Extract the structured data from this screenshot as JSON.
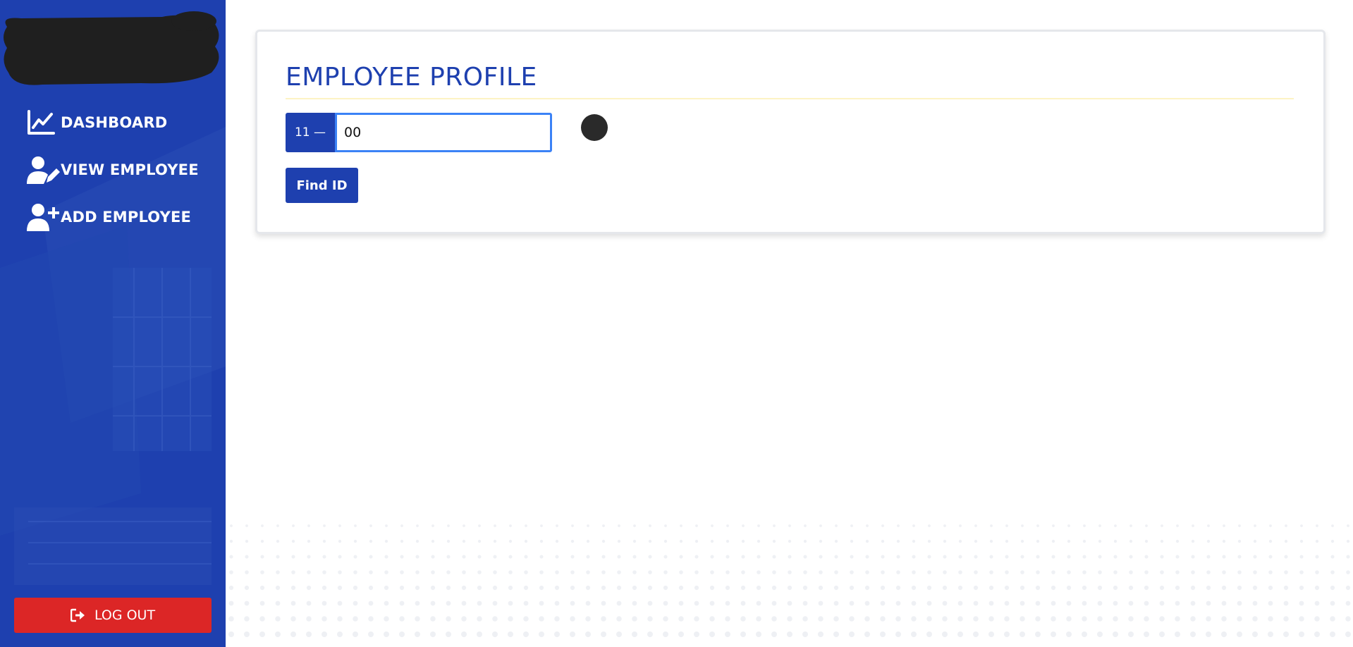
{
  "sidebar": {
    "items": [
      {
        "label": "DASHBOARD",
        "icon": "chart-line-icon"
      },
      {
        "label": "VIEW EMPLOYEE",
        "icon": "user-edit-icon"
      },
      {
        "label": "ADD EMPLOYEE",
        "icon": "user-plus-icon"
      }
    ],
    "logout": {
      "label": "LOG OUT",
      "icon": "sign-out-icon"
    }
  },
  "main": {
    "title": "EMPLOYEE PROFILE",
    "id_prefix": "11 —",
    "id_input": {
      "value": "00"
    },
    "find_button": "Find ID"
  },
  "colors": {
    "brand": "#1e40af",
    "danger": "#dc2626",
    "focus": "#3b82f6",
    "rule": "#fdf3c4"
  }
}
